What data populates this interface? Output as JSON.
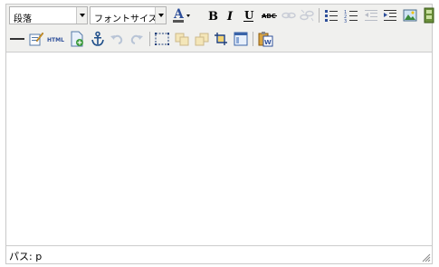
{
  "toolbar": {
    "format_select": {
      "value": "段落"
    },
    "fontsize_select": {
      "value": "フォントサイズ"
    },
    "buttons_row1": [
      {
        "name": "forecolor-icon",
        "glyph": "A",
        "color": "#3355aa",
        "enabled": true
      },
      {
        "name": "bold-icon",
        "glyph": "B",
        "enabled": true
      },
      {
        "name": "italic-icon",
        "glyph": "I",
        "enabled": true
      },
      {
        "name": "underline-icon",
        "glyph": "U",
        "enabled": true
      },
      {
        "name": "strikethrough-icon",
        "glyph": "ABC",
        "enabled": true
      },
      {
        "name": "link-icon",
        "enabled": false
      },
      {
        "name": "unlink-icon",
        "enabled": false
      },
      {
        "name": "bullet-list-icon",
        "enabled": true
      },
      {
        "name": "numbered-list-icon",
        "enabled": true
      },
      {
        "name": "outdent-icon",
        "enabled": false
      },
      {
        "name": "indent-icon",
        "enabled": true
      },
      {
        "name": "image-icon",
        "enabled": true
      },
      {
        "name": "media-icon",
        "enabled": true
      }
    ],
    "buttons_row2": [
      {
        "name": "horizontal-rule-icon",
        "enabled": true
      },
      {
        "name": "cleanup-icon",
        "enabled": true
      },
      {
        "name": "html-source-icon",
        "glyph": "HTML",
        "enabled": true
      },
      {
        "name": "document-add-icon",
        "enabled": true
      },
      {
        "name": "anchor-icon",
        "enabled": true
      },
      {
        "name": "undo-icon",
        "enabled": false
      },
      {
        "name": "redo-icon",
        "enabled": false
      },
      {
        "name": "visual-aid-icon",
        "enabled": true
      },
      {
        "name": "copy-icon",
        "enabled": false
      },
      {
        "name": "paste-icon",
        "enabled": false
      },
      {
        "name": "crop-icon",
        "enabled": true
      },
      {
        "name": "layer-icon",
        "enabled": true
      },
      {
        "name": "paste-word-icon",
        "enabled": true
      }
    ]
  },
  "statusbar": {
    "path_label": "パス:",
    "path_value": "p"
  },
  "colors": {
    "toolbar_bg": "#f0f0ee",
    "border": "#cccccc",
    "icon_blue": "#2e6bc6",
    "icon_disabled": "#b8c4d6"
  }
}
